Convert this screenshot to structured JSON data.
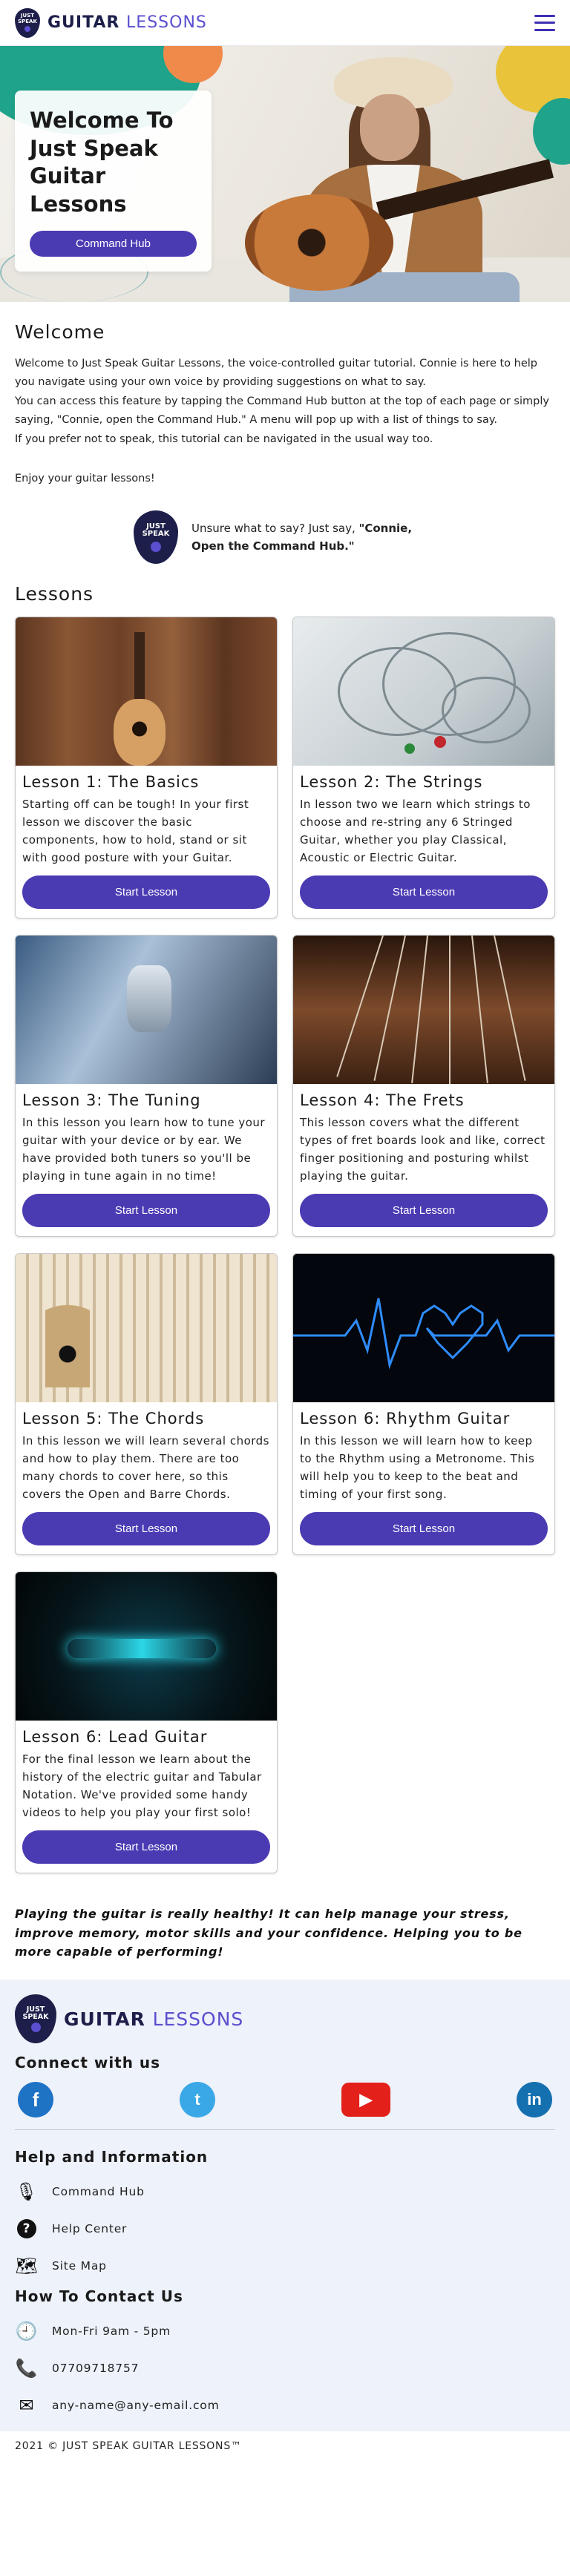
{
  "header": {
    "logo_line1": "JUST",
    "logo_line2": "SPEAK",
    "brand_main": "GUITAR",
    "brand_accent": "LESSONS",
    "menu_icon": "hamburger-menu-icon"
  },
  "hero": {
    "title": "Welcome To Just Speak Guitar Lessons",
    "button": "Command Hub"
  },
  "welcome": {
    "heading": "Welcome",
    "p1": "Welcome to Just Speak Guitar Lessons, the voice-controlled guitar tutorial. Connie is here to help you navigate using your own voice by providing suggestions on what to say.",
    "p2": "You can access this feature by tapping the Command Hub button at the top of each page or simply saying, \"Connie, open the Command Hub.\" A menu will pop up with a list of things to say.",
    "p3": "If you prefer not to speak, this tutorial can be navigated in the usual way too.",
    "p4": "Enjoy your guitar lessons!",
    "hint_plain": "Unsure what to say? Just say, ",
    "hint_bold": "\"Connie, Open the Command Hub.\""
  },
  "lessons": {
    "heading": "Lessons",
    "button_label": "Start Lesson",
    "items": [
      {
        "title": "Lesson 1: The Basics",
        "desc": "Starting off can be tough! In your first lesson we discover the basic components, how to hold, stand or sit with good posture with your Guitar."
      },
      {
        "title": "Lesson 2: The Strings",
        "desc": "In lesson two we learn which strings to choose and re-string any 6 Stringed Guitar, whether you play Classical, Acoustic or Electric Guitar."
      },
      {
        "title": "Lesson 3: The Tuning",
        "desc": "In this lesson you learn how to tune your guitar with your device or by ear. We have provided both tuners so you'll be playing in tune again in no time!"
      },
      {
        "title": "Lesson 4: The Frets",
        "desc": "This lesson covers what the different types of fret boards look and like, correct finger positioning and posturing whilst playing the guitar."
      },
      {
        "title": "Lesson 5: The Chords",
        "desc": "In this lesson we will learn several chords and how to play them. There are too many chords to cover here, so this covers the Open and Barre Chords."
      },
      {
        "title": "Lesson 6: Rhythm Guitar",
        "desc": "In this lesson we will learn how to keep to the Rhythm using a Metronome. This will help you to keep to the beat and timing of your first song."
      },
      {
        "title": "Lesson 6: Lead Guitar",
        "desc": "For the final lesson we learn about the history of the electric guitar and Tabular Notation. We've provided some handy videos to help you play your first solo!"
      }
    ]
  },
  "quote": "Playing the guitar is really healthy! It can help manage your stress, improve memory, motor skills and your confidence. Helping you to be more capable of performing!",
  "footer": {
    "connect_heading": "Connect with us",
    "social": {
      "facebook": "f",
      "twitter": "t",
      "youtube": "▶",
      "linkedin": "in"
    },
    "help_heading": "Help and Information",
    "help_items": [
      "Command Hub",
      "Help Center",
      "Site Map"
    ],
    "contact_heading": "How To Contact Us",
    "contact_items": [
      "Mon-Fri 9am - 5pm",
      "07709718757",
      "any-name@any-email.com"
    ],
    "copyright": "2021 © JUST SPEAK GUITAR LESSONS™"
  },
  "colors": {
    "accent": "#4a3bb3",
    "navy": "#1d1f4a",
    "footer_bg": "#eef2fa"
  }
}
